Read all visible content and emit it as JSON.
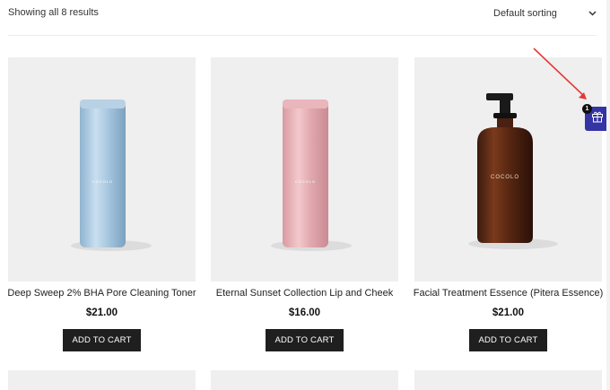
{
  "toolbar": {
    "result_count": "Showing all 8 results",
    "sorting_label": "Default sorting"
  },
  "products": [
    {
      "title": "Deep Sweep 2% BHA Pore Cleaning Toner",
      "price": "$21.00",
      "button": "ADD TO CART",
      "image": "light-blue-bottle",
      "brand": "COCOLO"
    },
    {
      "title": "Eternal Sunset Collection Lip and Cheek",
      "price": "$16.00",
      "button": "ADD TO CART",
      "image": "pink-bottle",
      "brand": "COCOLO"
    },
    {
      "title": "Facial Treatment Essence (Pitera Essence)",
      "price": "$21.00",
      "button": "ADD TO CART",
      "image": "amber-pump-bottle",
      "brand": "COCOLO"
    }
  ],
  "gift_widget": {
    "icon": "gift-icon",
    "badge_count": "1"
  },
  "colors": {
    "button": "#1f1f1f",
    "gift": "#3534a5",
    "card_bg": "#efefef",
    "arrow": "#e53935"
  }
}
